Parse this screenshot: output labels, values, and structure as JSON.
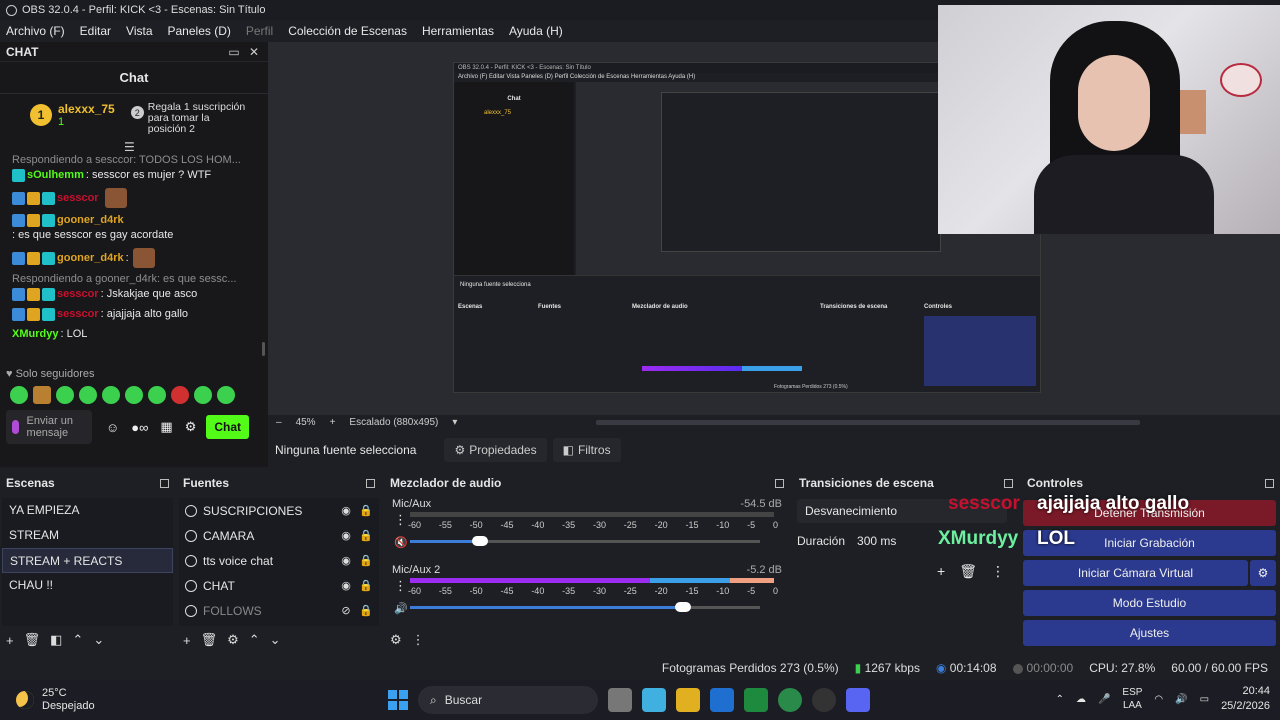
{
  "window": {
    "title": "OBS 32.0.4 - Perfil: KICK <3 - Escenas: Sin Título"
  },
  "menu": [
    "Archivo (F)",
    "Editar",
    "Vista",
    "Paneles (D)",
    "Perfil",
    "Colección de Escenas",
    "Herramientas",
    "Ayuda (H)"
  ],
  "chat": {
    "dock_title": "CHAT",
    "title": "Chat",
    "pinned": {
      "rank": "1",
      "user": "alexxx_75",
      "count": "1",
      "rank2": "2",
      "text": "Regala 1 suscripción para tomar la posición 2"
    },
    "messages": [
      {
        "reply": "Respondiendo a sesccor: TODOS LOS HOM...",
        "user": "sOulhemm",
        "user_color": "#53fc18",
        "text": ": sesscor es mujer ? WTF",
        "emote": false
      },
      {
        "reply": "",
        "user": "sesscor",
        "user_color": "#c8102e",
        "text": "",
        "emote": true
      },
      {
        "reply": "",
        "user": "gooner_d4rk",
        "user_color": "#e0a520",
        "text": ": es que sesscor es gay acordate",
        "emote": false
      },
      {
        "reply": "",
        "user": "gooner_d4rk",
        "user_color": "#e0a520",
        "text": ":",
        "emote": true
      },
      {
        "reply": "Respondiendo a gooner_d4rk: es que sessc...",
        "user": "sesscor",
        "user_color": "#c8102e",
        "text": ": Jskakjae que asco",
        "emote": false
      },
      {
        "reply": "",
        "user": "sesscor",
        "user_color": "#c8102e",
        "text": ": ajajjaja alto gallo",
        "emote": false
      },
      {
        "reply": "",
        "user": "XMurdyy",
        "user_color": "#53fc18",
        "text": ": LOL",
        "emote": false
      }
    ],
    "followers_label": "Solo seguidores",
    "input_placeholder": "Enviar un mensaje",
    "send_label": "Chat"
  },
  "preview": {
    "zoom": "45%",
    "scaling": "Escalado (880x495)",
    "nested": {
      "title": "OBS 32.0.4 - Perfil: KICK <3 - Escenas: Sin Título",
      "menu": "Archivo (F)   Editar   Vista   Paneles (D)   Perfil   Colección de Escenas   Herramientas   Ayuda (H)",
      "chat": "Chat",
      "pinned_user": "alexxx_75",
      "scenes_label": "Escenas",
      "sources_label": "Fuentes",
      "mixer_label": "Mezclador de audio",
      "transitions_label": "Transiciones de escena",
      "controls_label": "Controles",
      "no_source": "Ninguna fuente selecciona",
      "status": "Fotogramas Perdidos 273 (0.5%)"
    }
  },
  "overlay": {
    "user1": "sesscor",
    "msg1": "ajajjaja alto gallo",
    "user2": "XMurdyy",
    "msg2": "LOL"
  },
  "selection": {
    "no_source": "Ninguna fuente selecciona",
    "properties": "Propiedades",
    "filters": "Filtros"
  },
  "scenes": {
    "title": "Escenas",
    "items": [
      {
        "label": "YA EMPIEZA",
        "active": false
      },
      {
        "label": "STREAM",
        "active": false
      },
      {
        "label": "STREAM + REACTS",
        "active": true
      },
      {
        "label": "CHAU !!",
        "active": false
      }
    ]
  },
  "sources": {
    "title": "Fuentes",
    "items": [
      {
        "label": "SUSCRIPCIONES",
        "icon": "globe-icon",
        "visible": true
      },
      {
        "label": "CAMARA",
        "icon": "camera-icon",
        "visible": true
      },
      {
        "label": "tts voice chat",
        "icon": "globe-icon",
        "visible": true
      },
      {
        "label": "CHAT",
        "icon": "globe-icon",
        "visible": true
      },
      {
        "label": "FOLLOWS",
        "icon": "globe-icon",
        "visible": false
      }
    ]
  },
  "mixer": {
    "title": "Mezclador de audio",
    "tracks": [
      {
        "name": "Mic/Aux",
        "db": "-54.5 dB",
        "volume": 0.2,
        "level": 0.0,
        "muted": true
      },
      {
        "name": "Mic/Aux 2",
        "db": "-5.2 dB",
        "volume": 0.78,
        "level": 0.88,
        "muted": false
      }
    ],
    "scale": [
      "-60",
      "-55",
      "-50",
      "-45",
      "-40",
      "-35",
      "-30",
      "-25",
      "-20",
      "-15",
      "-10",
      "-5",
      "0"
    ]
  },
  "transitions": {
    "title": "Transiciones de escena",
    "selected": "Desvanecimiento",
    "duration_label": "Duración",
    "duration_value": "300 ms"
  },
  "controls": {
    "title": "Controles",
    "stop_stream": "Detener Transmisión",
    "start_recording": "Iniciar Grabación",
    "virtual_cam": "Iniciar Cámara Virtual",
    "studio_mode": "Modo Estudio",
    "settings": "Ajustes"
  },
  "status": {
    "dropped": "Fotogramas Perdidos 273 (0.5%)",
    "bitrate": "1267 kbps",
    "stream_time": "00:14:08",
    "rec_time": "00:00:00",
    "cpu": "CPU: 27.8%",
    "fps": "60.00 / 60.00 FPS"
  },
  "taskbar": {
    "temp": "25°C",
    "weather": "Despejado",
    "search": "Buscar",
    "lang1": "ESP",
    "lang2": "LAA",
    "time": "20:44",
    "date": "25/2/2026"
  }
}
